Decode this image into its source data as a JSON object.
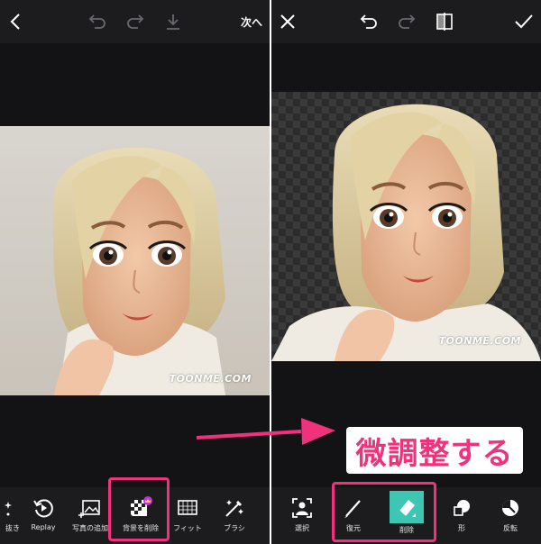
{
  "left": {
    "top_bar": {
      "next_label": "次へ",
      "icons": [
        "back-icon",
        "undo-icon",
        "redo-icon",
        "download-icon"
      ]
    },
    "watermark": "TOONME.COM",
    "tools": [
      {
        "label": "抜き",
        "icon": "sparkle-icon"
      },
      {
        "label": "Replay",
        "icon": "replay-icon"
      },
      {
        "label": "写真の追加",
        "icon": "add-photo-icon"
      },
      {
        "label": "背景を削除",
        "icon": "remove-background-icon",
        "highlighted": true,
        "badge": "crown-badge"
      },
      {
        "label": "フィット",
        "icon": "fit-icon"
      },
      {
        "label": "ブラシ",
        "icon": "brush-sparkle-icon"
      }
    ]
  },
  "right": {
    "top_bar": {
      "icons": [
        "close-icon",
        "undo-icon",
        "redo-icon",
        "compare-icon",
        "check-icon"
      ]
    },
    "watermark": "TOONME.COM",
    "tools": [
      {
        "label": "選択",
        "icon": "select-person-icon"
      },
      {
        "label": "復元",
        "icon": "restore-brush-icon"
      },
      {
        "label": "削除",
        "icon": "eraser-icon",
        "active": true
      },
      {
        "label": "形",
        "icon": "shape-icon"
      },
      {
        "label": "反転",
        "icon": "invert-icon"
      }
    ]
  },
  "annotation": {
    "callout_text": "微調整する",
    "arrow_color": "#f0317b",
    "highlight_color": "#f0317b",
    "accent_teal": "#3ec6b4"
  }
}
